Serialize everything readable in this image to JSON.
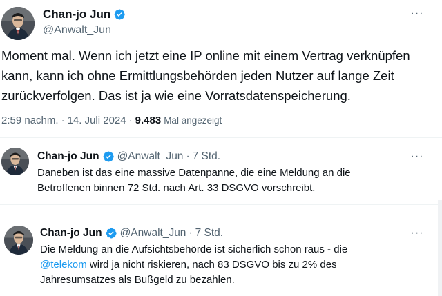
{
  "main_tweet": {
    "name": "Chan-jo Jun",
    "handle": "@Anwalt_Jun",
    "text": "Moment mal. Wenn ich jetzt eine IP online mit einem Vertrag verknüpfen kann, kann ich ohne Ermittlungsbehörden jeden Nutzer auf lange Zeit zurückverfolgen. Das ist ja wie eine Vorratsdatenspeicherung.",
    "time": "2:59 nachm.",
    "date": "14. Juli 2024",
    "separator": "·",
    "views_count": "9.483",
    "views_label": "Mal angezeigt",
    "more_label": "···"
  },
  "replies": [
    {
      "name": "Chan-jo Jun",
      "handle": "@Anwalt_Jun",
      "age": "7 Std.",
      "separator": "·",
      "text": "Daneben ist das eine massive Datenpanne, die eine Meldung an die Betroffenen binnen 72 Std. nach Art. 33 DSGVO vorschreibt.",
      "more_label": "···"
    },
    {
      "name": "Chan-jo Jun",
      "handle": "@Anwalt_Jun",
      "age": "7 Std.",
      "separator": "·",
      "text_before": "Die Meldung an die Aufsichtsbehörde ist sicherlich schon raus - die ",
      "mention": "@telekom",
      "text_after": " wird ja nicht riskieren, nach 83 DSGVO bis zu 2% des Jahresumsatzes als Bußgeld zu bezahlen.",
      "more_label": "···"
    }
  ],
  "colors": {
    "verified": "#1d9bf0",
    "link": "#1d9bf0",
    "muted": "#536471",
    "text": "#0f1419"
  },
  "icons": {
    "verified": "verified-badge-icon",
    "more": "more-options-icon",
    "avatar": "avatar-photo"
  }
}
